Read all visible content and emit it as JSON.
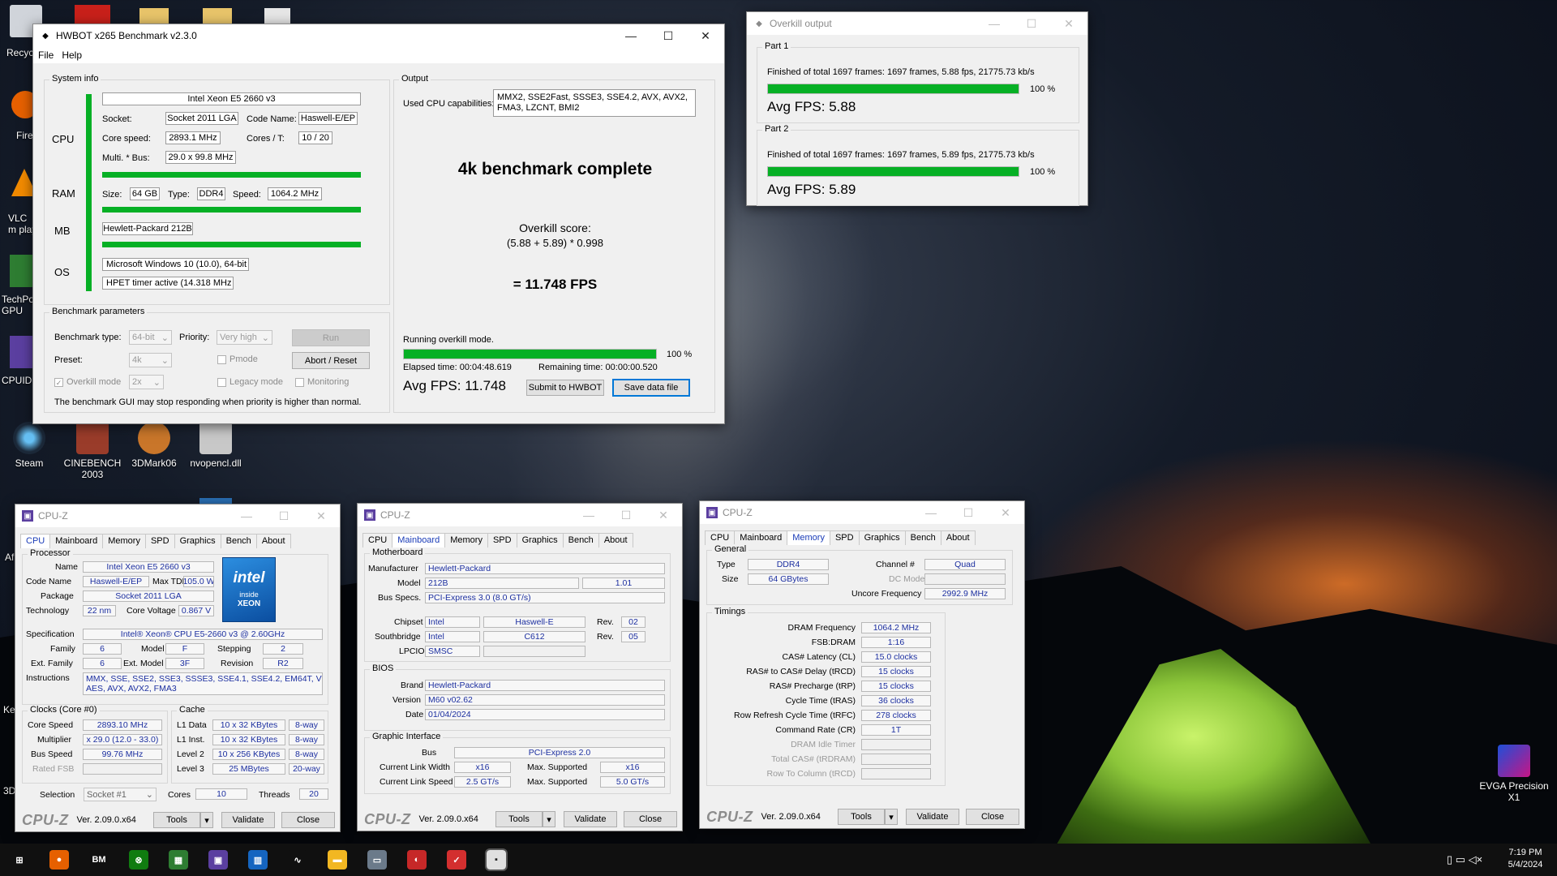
{
  "desktop": {
    "icons": [
      {
        "label": "Steam",
        "color": "#1b2838"
      },
      {
        "label": "CINEBENCH 2003",
        "color": "#9a3c2a"
      },
      {
        "label": "3DMark06",
        "color": "#c9762a"
      },
      {
        "label": "nvopencl.dll",
        "color": "#c8c8c8"
      },
      {
        "label": "EVGA Precision X1",
        "color": "#c71585"
      }
    ],
    "partial_labels": [
      "Recyc",
      "Fire",
      "VLC m play",
      "TechPo GPU",
      "CPUID",
      "Af",
      "Ke",
      "3D"
    ]
  },
  "hwbot": {
    "title": "HWBOT x265 Benchmark v2.3.0",
    "menu": [
      "File",
      "Help"
    ],
    "system_info": {
      "group_label": "System info",
      "cpu_label": "CPU",
      "ram_label": "RAM",
      "mb_label": "MB",
      "os_label": "OS",
      "cpu_name": "Intel Xeon E5 2660 v3",
      "socket_label": "Socket:",
      "socket": "Socket 2011 LGA",
      "codename_label": "Code Name:",
      "codename": "Haswell-E/EP",
      "core_speed_label": "Core speed:",
      "core_speed": "2893.1 MHz",
      "cores_label": "Cores / T:",
      "cores": "10 / 20",
      "multi_label": "Multi. * Bus:",
      "multi": "29.0 x 99.8 MHz",
      "size_label": "Size:",
      "ram_size": "64 GB",
      "type_label": "Type:",
      "ram_type": "DDR4",
      "speed_label": "Speed:",
      "ram_speed": "1064.2 MHz",
      "mb": "Hewlett-Packard 212B",
      "os": "Microsoft Windows 10 (10.0), 64-bit",
      "timer": "HPET timer active (14.318 MHz )"
    },
    "params": {
      "group_label": "Benchmark parameters",
      "type_label": "Benchmark type:",
      "type": "64-bit",
      "priority_label": "Priority:",
      "priority": "Very high",
      "run": "Run",
      "preset_label": "Preset:",
      "preset": "4k",
      "pmode": "Pmode",
      "abort": "Abort / Reset",
      "overkill_label": "Overkill mode",
      "overkill": "2x",
      "legacy": "Legacy mode",
      "monitoring": "Monitoring",
      "warning": "The benchmark GUI may stop responding when priority is higher than normal."
    },
    "output": {
      "group_label": "Output",
      "cap_label": "Used CPU capabilities:",
      "cap1": "MMX2, SSE2Fast, SSSE3, SSE4.2, AVX, AVX2,",
      "cap2": "FMA3, LZCNT, BMI2",
      "headline": "4k benchmark complete",
      "score_label": "Overkill score:",
      "formula": "(5.88 + 5.89) * 0.998",
      "result": "= 11.748 FPS",
      "status": "Running overkill mode.",
      "progress": 1.0,
      "progress_text": "100 %",
      "elapsed": "Elapsed time: 00:04:48.619",
      "remaining": "Remaining time: 00:00:00.520",
      "avg": "Avg FPS: 11.748",
      "submit": "Submit to HWBOT",
      "save": "Save data file"
    }
  },
  "overkill": {
    "title": "Overkill output",
    "parts": [
      {
        "label": "Part 1",
        "status": "Finished of total 1697 frames: 1697 frames, 5.88 fps,  21775.73 kb/s",
        "progress": 1.0,
        "pct": "100 %",
        "avg": "Avg FPS: 5.88"
      },
      {
        "label": "Part 2",
        "status": "Finished of total 1697 frames: 1697 frames, 5.89 fps,  21775.73 kb/s",
        "progress": 1.0,
        "pct": "100 %",
        "avg": "Avg FPS: 5.89"
      }
    ]
  },
  "cpuz": {
    "title": "CPU-Z",
    "tabs": [
      "CPU",
      "Mainboard",
      "Memory",
      "SPD",
      "Graphics",
      "Bench",
      "About"
    ],
    "logo": "CPU-Z",
    "version": "Ver. 2.09.0.x64",
    "tools": "Tools",
    "validate": "Validate",
    "close": "Close",
    "cpu": {
      "processor": "Processor",
      "name_l": "Name",
      "name": "Intel Xeon E5 2660 v3",
      "code_l": "Code Name",
      "code": "Haswell-E/EP",
      "tdp_l": "Max TDP",
      "tdp": "105.0 W",
      "pkg_l": "Package",
      "pkg": "Socket 2011 LGA",
      "tech_l": "Technology",
      "tech": "22 nm",
      "volt_l": "Core Voltage",
      "volt": "0.867 V",
      "spec_l": "Specification",
      "spec": "Intel® Xeon® CPU E5-2660 v3 @ 2.60GHz",
      "fam_l": "Family",
      "fam": "6",
      "model_l": "Model",
      "model": "F",
      "step_l": "Stepping",
      "step": "2",
      "efam_l": "Ext. Family",
      "efam": "6",
      "emodel_l": "Ext. Model",
      "emodel": "3F",
      "rev_l": "Revision",
      "rev": "R2",
      "instr_l": "Instructions",
      "instr1": "MMX, SSE, SSE2, SSE3, SSSE3, SSE4.1, SSE4.2, EM64T, VT-x,",
      "instr2": "AES, AVX, AVX2, FMA3",
      "clocks": "Clocks (Core #0)",
      "cs_l": "Core Speed",
      "cs": "2893.10 MHz",
      "mul_l": "Multiplier",
      "mul": "x 29.0 (12.0 - 33.0)",
      "bus_l": "Bus Speed",
      "bus": "99.76 MHz",
      "fsb_l": "Rated FSB",
      "cache": "Cache",
      "l1d_l": "L1 Data",
      "l1d": "10 x 32 KBytes",
      "l1d_w": "8-way",
      "l1i_l": "L1 Inst.",
      "l1i": "10 x 32 KBytes",
      "l1i_w": "8-way",
      "l2_l": "Level 2",
      "l2": "10 x 256 KBytes",
      "l2_w": "8-way",
      "l3_l": "Level 3",
      "l3": "25 MBytes",
      "l3_w": "20-way",
      "sel_l": "Selection",
      "sel": "Socket #1",
      "cores_l": "Cores",
      "cores": "10",
      "thr_l": "Threads",
      "thr": "20",
      "badge_brand": "intel",
      "badge_inside": "inside",
      "badge_xeon": "XEON"
    },
    "mainboard": {
      "motherboard": "Motherboard",
      "mfr_l": "Manufacturer",
      "mfr": "Hewlett-Packard",
      "model_l": "Model",
      "model": "212B",
      "model_rev": "1.01",
      "busspec_l": "Bus Specs.",
      "busspec": "PCI-Express 3.0 (8.0 GT/s)",
      "chip_l": "Chipset",
      "chip_v": "Intel",
      "chip": "Haswell-E",
      "rev_l": "Rev.",
      "chip_rev": "02",
      "south_l": "Southbridge",
      "south_v": "Intel",
      "south": "C612",
      "south_rev": "05",
      "lpc_l": "LPCIO",
      "lpc": "SMSC",
      "bios": "BIOS",
      "brand_l": "Brand",
      "brand": "Hewlett-Packard",
      "ver_l": "Version",
      "ver": "M60 v02.62",
      "date_l": "Date",
      "date": "01/04/2024",
      "gi": "Graphic Interface",
      "gbus_l": "Bus",
      "gbus": "PCI-Express 2.0",
      "clw_l": "Current Link Width",
      "clw": "x16",
      "msw_l": "Max. Supported",
      "msw": "x16",
      "cls_l": "Current Link Speed",
      "cls": "2.5 GT/s",
      "mss_l": "Max. Supported",
      "mss": "5.0 GT/s"
    },
    "memory": {
      "general": "General",
      "type_l": "Type",
      "type": "DDR4",
      "chan_l": "Channel #",
      "chan": "Quad",
      "size_l": "Size",
      "size": "64 GBytes",
      "dc_l": "DC Mode",
      "uncore_l": "Uncore Frequency",
      "uncore": "2992.9 MHz",
      "timings": "Timings",
      "rows": [
        {
          "l": "DRAM Frequency",
          "v": "1064.2 MHz"
        },
        {
          "l": "FSB:DRAM",
          "v": "1:16"
        },
        {
          "l": "CAS# Latency (CL)",
          "v": "15.0 clocks"
        },
        {
          "l": "RAS# to CAS# Delay (tRCD)",
          "v": "15 clocks"
        },
        {
          "l": "RAS# Precharge (tRP)",
          "v": "15 clocks"
        },
        {
          "l": "Cycle Time (tRAS)",
          "v": "36 clocks"
        },
        {
          "l": "Row Refresh Cycle Time (tRFC)",
          "v": "278 clocks"
        },
        {
          "l": "Command Rate (CR)",
          "v": "1T"
        },
        {
          "l": "DRAM Idle Timer",
          "v": ""
        },
        {
          "l": "Total CAS# (tRDRAM)",
          "v": ""
        },
        {
          "l": "Row To Column (tRCD)",
          "v": ""
        }
      ]
    }
  },
  "taskbar": {
    "apps": [
      {
        "name": "start",
        "glyph": "⊞",
        "color": "#101010"
      },
      {
        "name": "firefox",
        "glyph": "●",
        "color": "#e66000"
      },
      {
        "name": "benchmate",
        "glyph": "BM",
        "color": "#101010"
      },
      {
        "name": "xbox",
        "glyph": "⊗",
        "color": "#107c10"
      },
      {
        "name": "gpu-z",
        "glyph": "▦",
        "color": "#2e7d32"
      },
      {
        "name": "cpu-z",
        "glyph": "▣",
        "color": "#5b3fa0"
      },
      {
        "name": "hwinfo",
        "glyph": "▥",
        "color": "#1565c0"
      },
      {
        "name": "monitor",
        "glyph": "∿",
        "color": "#101010"
      },
      {
        "name": "explorer",
        "glyph": "▬",
        "color": "#f2b722"
      },
      {
        "name": "remote",
        "glyph": "▭",
        "color": "#6b7a8a"
      },
      {
        "name": "cinebench",
        "glyph": "◐",
        "color": "#c62828"
      },
      {
        "name": "hwbot",
        "glyph": "✓",
        "color": "#d32f2f"
      },
      {
        "name": "x265",
        "glyph": "▪",
        "color": "#e0e0e0"
      }
    ],
    "time": "7:19 PM",
    "date": "5/4/2024"
  }
}
